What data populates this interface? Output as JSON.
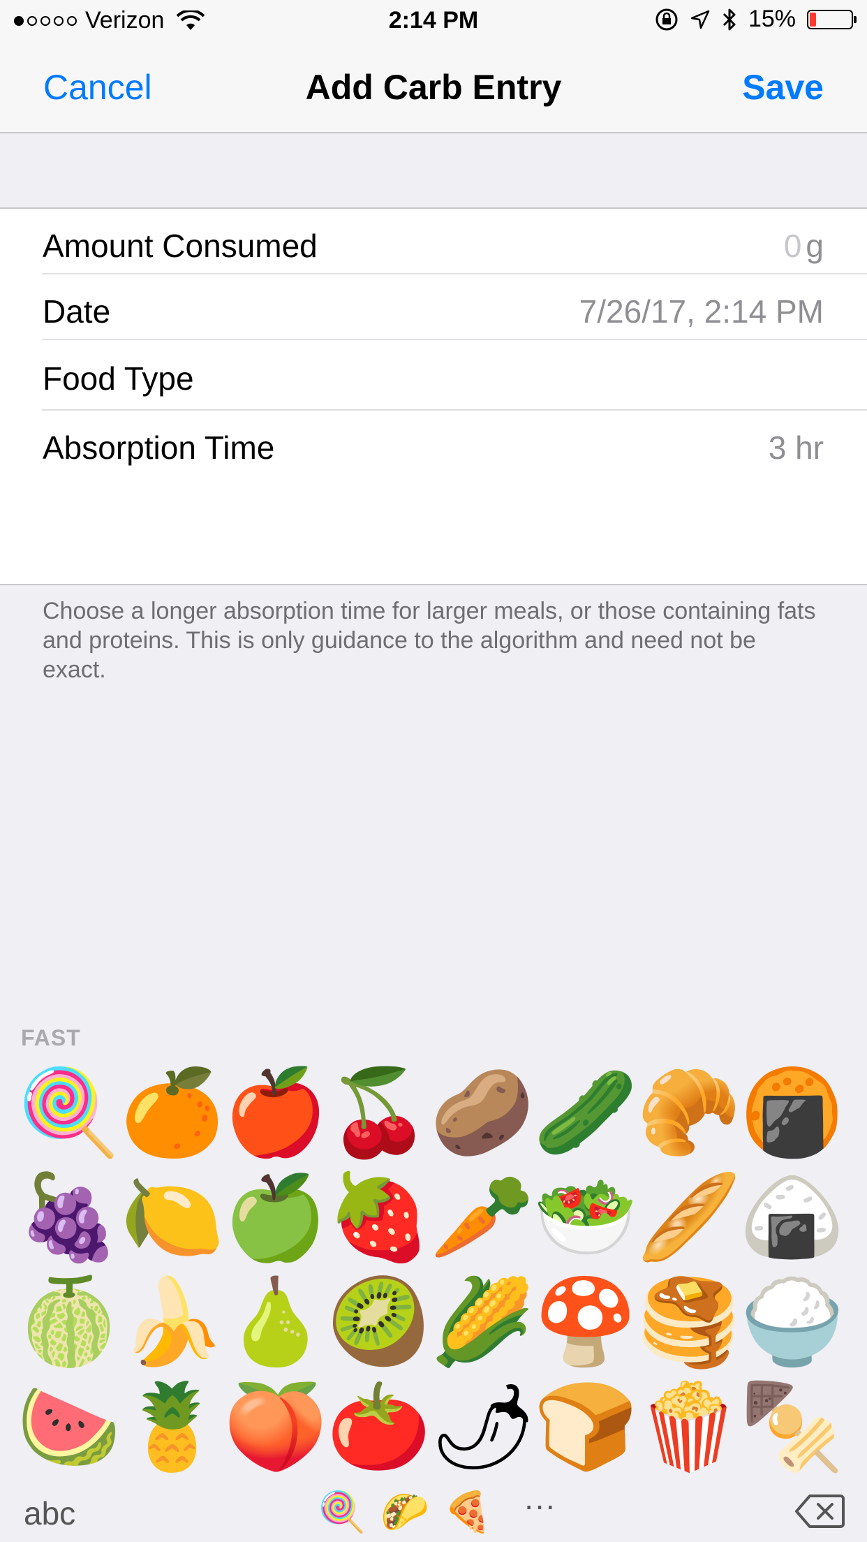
{
  "status_bar": {
    "carrier": "Verizon",
    "time": "2:14 PM",
    "battery_percent": "15%",
    "battery_level": 0.15,
    "battery_color": "#ff3b30",
    "signal_bars_filled": 1,
    "signal_bars_total": 5
  },
  "nav": {
    "cancel_label": "Cancel",
    "title": "Add Carb Entry",
    "save_label": "Save",
    "accent_color": "#007aff"
  },
  "form": {
    "amount_label": "Amount Consumed",
    "amount_placeholder": "0",
    "amount_unit": "g",
    "date_label": "Date",
    "date_value": "7/26/17, 2:14 PM",
    "food_type_label": "Food Type",
    "food_type_value": "",
    "absorption_label": "Absorption Time",
    "absorption_value": "3 hr",
    "footer_note": "Choose a longer absorption time for larger meals, or those containing fats and proteins. This is only guidance to the algorithm and need not be exact."
  },
  "keyboard": {
    "section_label": "FAST",
    "emoji_rows": [
      [
        "🍭",
        "🍊",
        "🍎",
        "🍒",
        "🥔",
        "🥒",
        "🥐",
        "🍘"
      ],
      [
        "🍇",
        "🍋",
        "🍏",
        "🍓",
        "🥕",
        "🥗",
        "🥖",
        "🍙"
      ],
      [
        "🍈",
        "🍌",
        "🍐",
        "🥝",
        "🌽",
        "🍄",
        "🥞",
        "🍚"
      ],
      [
        "🍉",
        "🍍",
        "🍑",
        "🍅",
        "🌶",
        "🍞",
        "🍿",
        "🍢"
      ]
    ],
    "abc_label": "abc",
    "category_icons": [
      "🍭",
      "🌮",
      "🍕"
    ],
    "more_label": "···",
    "delete_icon": "delete-backspace-icon"
  }
}
